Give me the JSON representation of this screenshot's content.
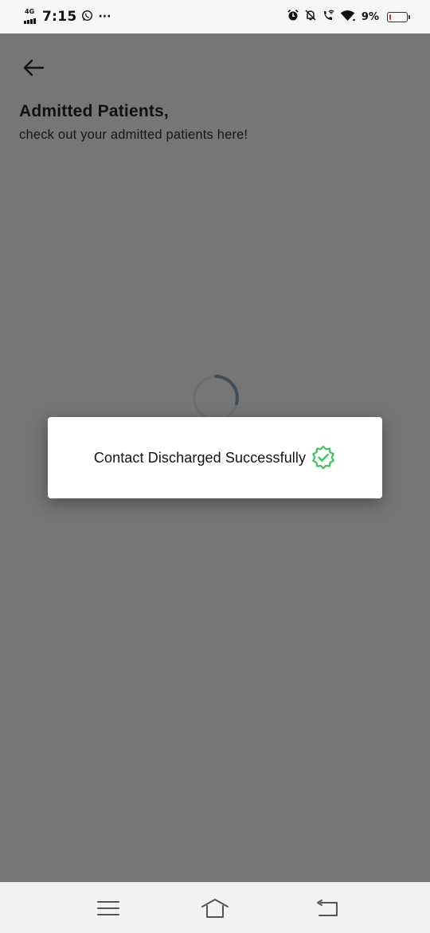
{
  "status_bar": {
    "network_label": "4G",
    "time": "7:15",
    "more_indicator": "···",
    "battery_percent": "9%",
    "battery_level": 0.09,
    "icons": [
      "whatsapp-icon",
      "alarm-icon",
      "mute-notification-icon",
      "wifi-calling-icon",
      "wifi-icon",
      "battery-icon"
    ]
  },
  "header": {
    "title": "Admitted Patients,",
    "subtitle": "check out your admitted patients here!"
  },
  "dialog": {
    "message": "Contact Discharged Successfully",
    "icon": "verified-check-icon",
    "icon_color": "#3cc35a"
  },
  "nav_bar": {
    "items": [
      "menu-icon",
      "home-icon",
      "back-icon"
    ]
  },
  "colors": {
    "overlay_background": "#767676",
    "status_bar_background": "#f6f6f6",
    "battery_low": "#e03030",
    "spinner": "#3f4d57"
  }
}
